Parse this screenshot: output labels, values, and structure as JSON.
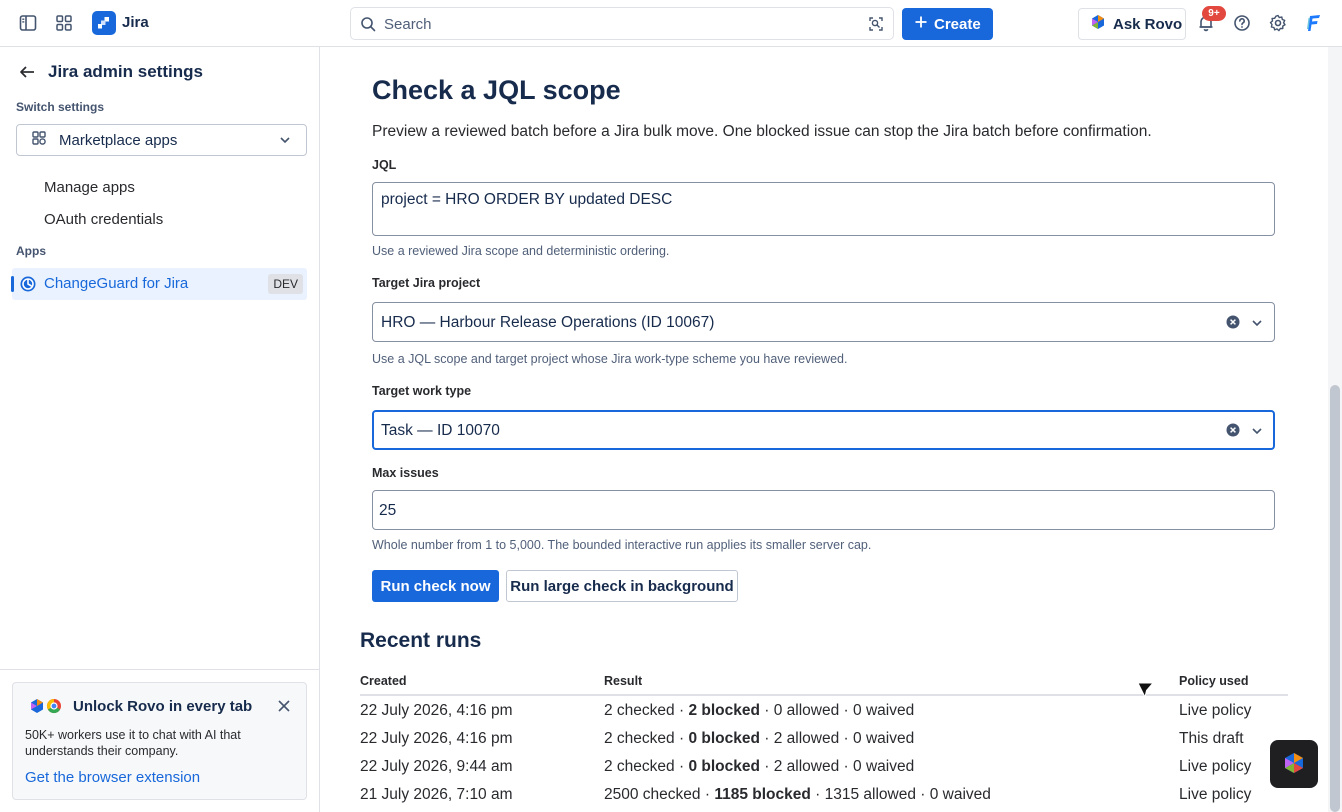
{
  "topbar": {
    "app_name": "Jira",
    "search_placeholder": "Search",
    "create_label": "Create",
    "ask_rovo_label": "Ask Rovo",
    "notifications_badge": "9+"
  },
  "sidebar": {
    "title": "Jira admin settings",
    "switch_label": "Switch settings",
    "switch_value": "Marketplace apps",
    "items": [
      {
        "label": "Manage apps"
      },
      {
        "label": "OAuth credentials"
      }
    ],
    "apps_label": "Apps",
    "app": {
      "label": "ChangeGuard for Jira",
      "tag": "DEV"
    },
    "promo": {
      "title": "Unlock Rovo in every tab",
      "description": "50K+ workers use it to chat with AI that understands their company.",
      "link": "Get the browser extension"
    }
  },
  "main": {
    "title": "Check a JQL scope",
    "description": "Preview a reviewed batch before a Jira bulk move. One blocked issue can stop the Jira batch before confirmation.",
    "jql": {
      "label": "JQL",
      "value": "project = HRO ORDER BY updated DESC",
      "help": "Use a reviewed Jira scope and deterministic ordering."
    },
    "target_project": {
      "label": "Target Jira project",
      "value": "HRO — Harbour Release Operations (ID 10067)",
      "help": "Use a JQL scope and target project whose Jira work-type scheme you have reviewed."
    },
    "target_work_type": {
      "label": "Target work type",
      "value": "Task — ID 10070"
    },
    "max_issues": {
      "label": "Max issues",
      "value": "25",
      "help": "Whole number from 1 to 5,000. The bounded interactive run applies its smaller server cap."
    },
    "run_now_label": "Run check now",
    "run_background_label": "Run large check in background",
    "recent_runs": {
      "title": "Recent runs",
      "columns": [
        "Created",
        "Result",
        "Policy used"
      ],
      "rows": [
        {
          "created": "22 July 2026, 4:16 pm",
          "checked": "2 checked",
          "blocked": "2 blocked",
          "allowed": "0 allowed",
          "waived": "0 waived",
          "policy": "Live policy"
        },
        {
          "created": "22 July 2026, 4:16 pm",
          "checked": "2 checked",
          "blocked": "0 blocked",
          "allowed": "2 allowed",
          "waived": "0 waived",
          "policy": "This draft"
        },
        {
          "created": "22 July 2026, 9:44 am",
          "checked": "2 checked",
          "blocked": "0 blocked",
          "allowed": "2 allowed",
          "waived": "0 waived",
          "policy": "Live policy"
        },
        {
          "created": "21 July 2026, 7:10 am",
          "checked": "2500 checked",
          "blocked": "1185 blocked",
          "allowed": "1315 allowed",
          "waived": "0 waived",
          "policy": "Live policy"
        }
      ]
    }
  },
  "colors": {
    "brand": "#1868db",
    "text": "#172b4d",
    "border": "#dfe1e6"
  }
}
